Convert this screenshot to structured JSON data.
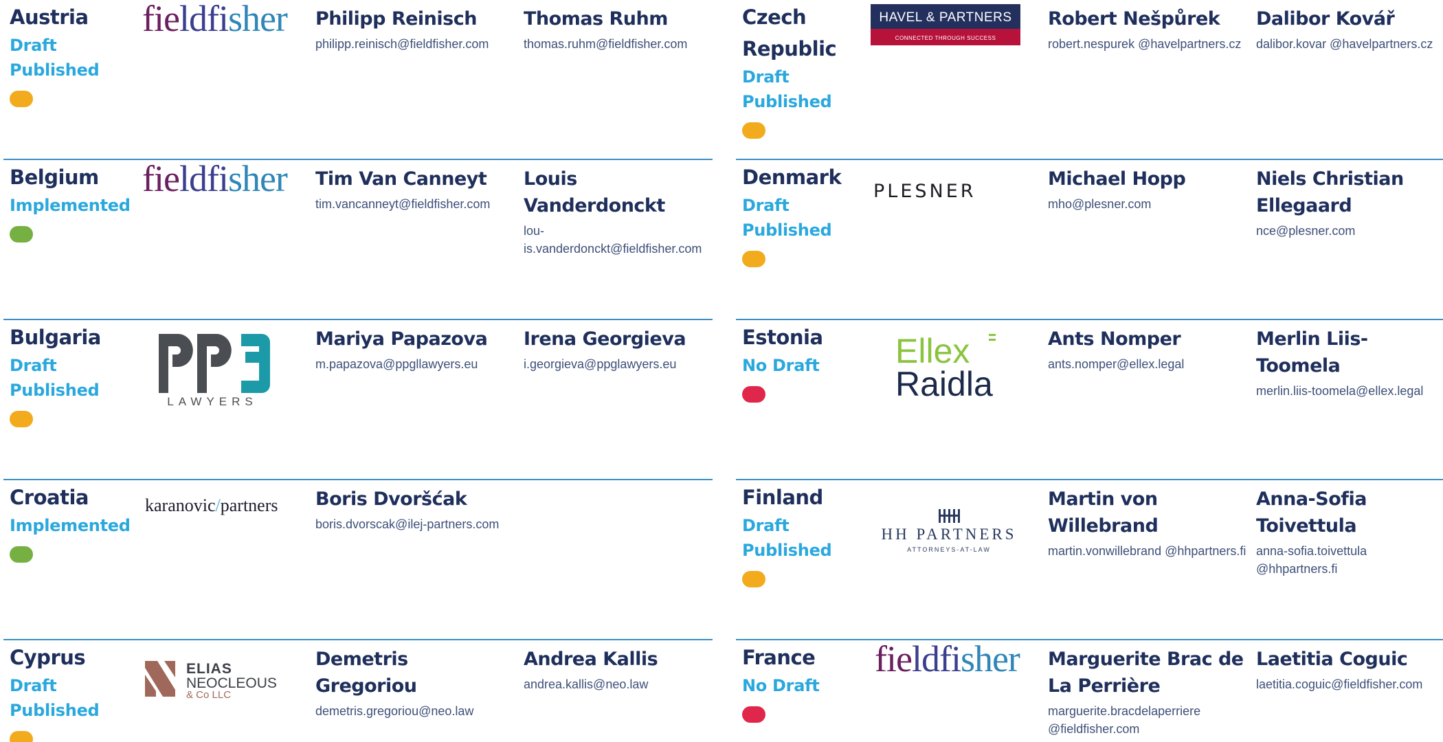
{
  "colors": {
    "draft_published": "#f2ab1d",
    "implemented": "#76b043",
    "no_draft": "#e0264b",
    "divider": "#3b8fc4",
    "name": "#1f2f5c",
    "status": "#2aa8de"
  },
  "left": [
    {
      "country": "Austria",
      "status": [
        "Draft",
        "Published"
      ],
      "status_color": "#f2ab1d",
      "logo": "fieldfisher-logo",
      "contacts": [
        {
          "name": "Philipp Reinisch",
          "email": "philipp.reinisch@fieldfisher.com"
        },
        {
          "name": "Thomas Ruhm",
          "email": "thomas.ruhm@fieldfisher.com"
        }
      ]
    },
    {
      "country": "Belgium",
      "status": [
        "Implemented"
      ],
      "status_color": "#76b043",
      "logo": "fieldfisher-logo",
      "contacts": [
        {
          "name": "Tim Van Canneyt",
          "email": "tim.vancanneyt@fieldfisher.com"
        },
        {
          "name": "Louis Vanderdonckt",
          "email": "lou-is.vanderdonckt@fieldfisher.com"
        }
      ]
    },
    {
      "country": "Bulgaria",
      "status": [
        "Draft",
        "Published"
      ],
      "status_color": "#f2ab1d",
      "logo": "ppg-lawyers-logo",
      "logo_text": "LAWYERS",
      "contacts": [
        {
          "name": "Mariya Papazova",
          "email": "m.papazova@ppgllawyers.eu"
        },
        {
          "name": "Irena Georgieva",
          "email": "i.georgieva@ppglawyers.eu"
        }
      ]
    },
    {
      "country": "Croatia",
      "status": [
        "Implemented"
      ],
      "status_color": "#76b043",
      "logo": "karanovic-partners-logo",
      "logo_text": [
        "karanovic",
        "/",
        "partners"
      ],
      "contacts": [
        {
          "name": "Boris Dvoršćak",
          "email": "boris.dvorscak@ilej-partners.com"
        }
      ]
    },
    {
      "country": "Cyprus",
      "status": [
        "Draft",
        "Published"
      ],
      "status_color": "#f2ab1d",
      "logo": "elias-neocleous-logo",
      "logo_text": [
        "ELIAS",
        "NEOCLEOUS",
        "& Co LLC"
      ],
      "contacts": [
        {
          "name": "Demetris Gregoriou",
          "email": "demetris.gregoriou@neo.law"
        },
        {
          "name": "Andrea Kallis",
          "email": "andrea.kallis@neo.law"
        }
      ]
    }
  ],
  "right": [
    {
      "country": "Czech Republic",
      "status": [
        "Draft",
        "Published"
      ],
      "status_color": "#f2ab1d",
      "logo": "havel-partners-logo",
      "logo_text": [
        "HAVEL & PARTNERS",
        "CONNECTED THROUGH SUCCESS"
      ],
      "contacts": [
        {
          "name": "Robert Nešpůrek",
          "email": "robert.nespurek @havelpartners.cz"
        },
        {
          "name": "Dalibor Kovář",
          "email": "dalibor.kovar @havelpartners.cz"
        }
      ]
    },
    {
      "country": "Denmark",
      "status": [
        "Draft",
        "Published"
      ],
      "status_color": "#f2ab1d",
      "logo": "plesner-logo",
      "logo_text": "PLESNER",
      "contacts": [
        {
          "name": "Michael Hopp",
          "email": "mho@plesner.com"
        },
        {
          "name": "Niels Christian Ellegaard",
          "email": "nce@plesner.com"
        }
      ]
    },
    {
      "country": "Estonia",
      "status": [
        "No Draft"
      ],
      "status_color": "#e0264b",
      "logo": "ellex-raidla-logo",
      "logo_text": [
        "Ellex",
        "Raidla"
      ],
      "contacts": [
        {
          "name": "Ants Nomper",
          "email": "ants.nomper@ellex.legal"
        },
        {
          "name": "Merlin Liis-Toomela",
          "email": "merlin.liis-toomela@ellex.legal"
        }
      ]
    },
    {
      "country": "Finland",
      "status": [
        "Draft",
        "Published"
      ],
      "status_color": "#f2ab1d",
      "logo": "hh-partners-logo",
      "logo_text": [
        "HH PARTNERS",
        "ATTORNEYS-AT-LAW"
      ],
      "contacts": [
        {
          "name": "Martin von Willebrand",
          "email": "martin.vonwillebrand @hhpartners.fi"
        },
        {
          "name": "Anna-Sofia Toivettula",
          "email": "anna-sofia.toivettula @hhpartners.fi"
        }
      ]
    },
    {
      "country": "France",
      "status": [
        "No Draft"
      ],
      "status_color": "#e0264b",
      "logo": "fieldfisher-logo",
      "contacts": [
        {
          "name": "Marguerite Brac de La Perrière",
          "email": "marguerite.bracdelaperriere @fieldfisher.com"
        },
        {
          "name": "Laetitia Coguic",
          "email": "laetitia.coguic@fieldfisher.com"
        }
      ]
    }
  ]
}
